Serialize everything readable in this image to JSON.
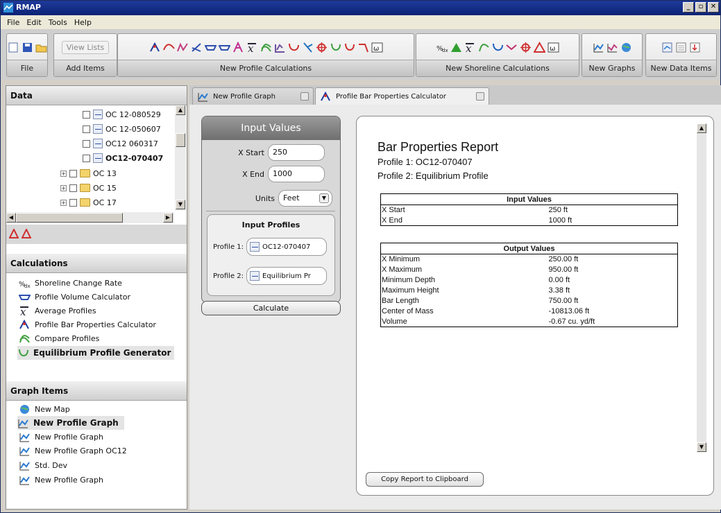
{
  "window": {
    "title": "RMAP",
    "min_glyph": "_",
    "max_glyph": "▫",
    "close_glyph": "✕"
  },
  "menu": [
    "File",
    "Edit",
    "Tools",
    "Help"
  ],
  "ribbon": {
    "groups": [
      {
        "label": "File"
      },
      {
        "label": "Add Items",
        "view_lists": "View Lists"
      },
      {
        "label": "New Profile Calculations"
      },
      {
        "label": "New Shoreline Calculations"
      },
      {
        "label": "New Graphs"
      },
      {
        "label": "New Data Items"
      }
    ]
  },
  "data_panel": {
    "header": "Data",
    "tree": [
      {
        "label": "OC 12-080529",
        "type": "file"
      },
      {
        "label": "OC 12-050607",
        "type": "file"
      },
      {
        "label": "OC12 060317",
        "type": "file"
      },
      {
        "label": "OC12-070407",
        "type": "file",
        "bold": true
      },
      {
        "label": "OC 13",
        "type": "folder"
      },
      {
        "label": "OC 15",
        "type": "folder"
      },
      {
        "label": "OC 17",
        "type": "folder"
      }
    ]
  },
  "calculations": {
    "header": "Calculations",
    "items": [
      {
        "label": "Shoreline Change Rate",
        "icon": "shoreline-rate-icon"
      },
      {
        "label": "Profile Volume Calculator",
        "icon": "volume-icon"
      },
      {
        "label": "Average Profiles",
        "icon": "average-icon"
      },
      {
        "label": "Profile Bar Properties Calculator",
        "icon": "bar-properties-icon"
      },
      {
        "label": "Compare Profiles",
        "icon": "compare-icon"
      },
      {
        "label": "Equilibrium Profile Generator",
        "icon": "equilibrium-icon",
        "bold": true
      }
    ]
  },
  "graph_items": {
    "header": "Graph Items",
    "items": [
      {
        "label": "New Map",
        "icon": "globe-icon"
      },
      {
        "label": "New Profile Graph",
        "icon": "profile-graph-icon",
        "bold": true
      },
      {
        "label": "New Profile Graph",
        "icon": "profile-graph-icon"
      },
      {
        "label": "New Profile Graph OC12",
        "icon": "profile-graph-icon"
      },
      {
        "label": "Std. Dev",
        "icon": "profile-graph-icon"
      },
      {
        "label": "New Profile Graph",
        "icon": "profile-graph-icon"
      }
    ]
  },
  "tabs": [
    {
      "label": "New Profile Graph",
      "active": false
    },
    {
      "label": "Profile Bar Properties Calculator",
      "active": true
    }
  ],
  "input_values": {
    "header": "Input Values",
    "x_start_label": "X Start",
    "x_start": "250",
    "x_end_label": "X End",
    "x_end": "1000",
    "units_label": "Units",
    "units": "Feet",
    "profiles_header": "Input Profiles",
    "profile1_label": "Profile 1:",
    "profile1": "OC12-070407",
    "profile2_label": "Profile 2:",
    "profile2": "Equilibrium Pr",
    "calculate": "Calculate"
  },
  "report": {
    "title": "Bar Properties Report",
    "profile1": "Profile 1: OC12-070407",
    "profile2": "Profile 2: Equilibrium Profile",
    "input_header": "Input Values",
    "inputs": [
      {
        "name": "X Start",
        "value": "250 ft"
      },
      {
        "name": "X End",
        "value": "1000 ft"
      }
    ],
    "output_header": "Output Values",
    "outputs": [
      {
        "name": "X Minimum",
        "value": "250.00 ft"
      },
      {
        "name": "X Maximum",
        "value": "950.00 ft"
      },
      {
        "name": "Minimum Depth",
        "value": "0.00 ft"
      },
      {
        "name": "Maximum Height",
        "value": "3.38 ft"
      },
      {
        "name": "Bar Length",
        "value": "750.00 ft"
      },
      {
        "name": "Center of Mass",
        "value": "-10813.06 ft"
      },
      {
        "name": "Volume",
        "value": "-0.67 cu. yd/ft"
      }
    ],
    "copy_button": "Copy Report to Clipboard"
  }
}
